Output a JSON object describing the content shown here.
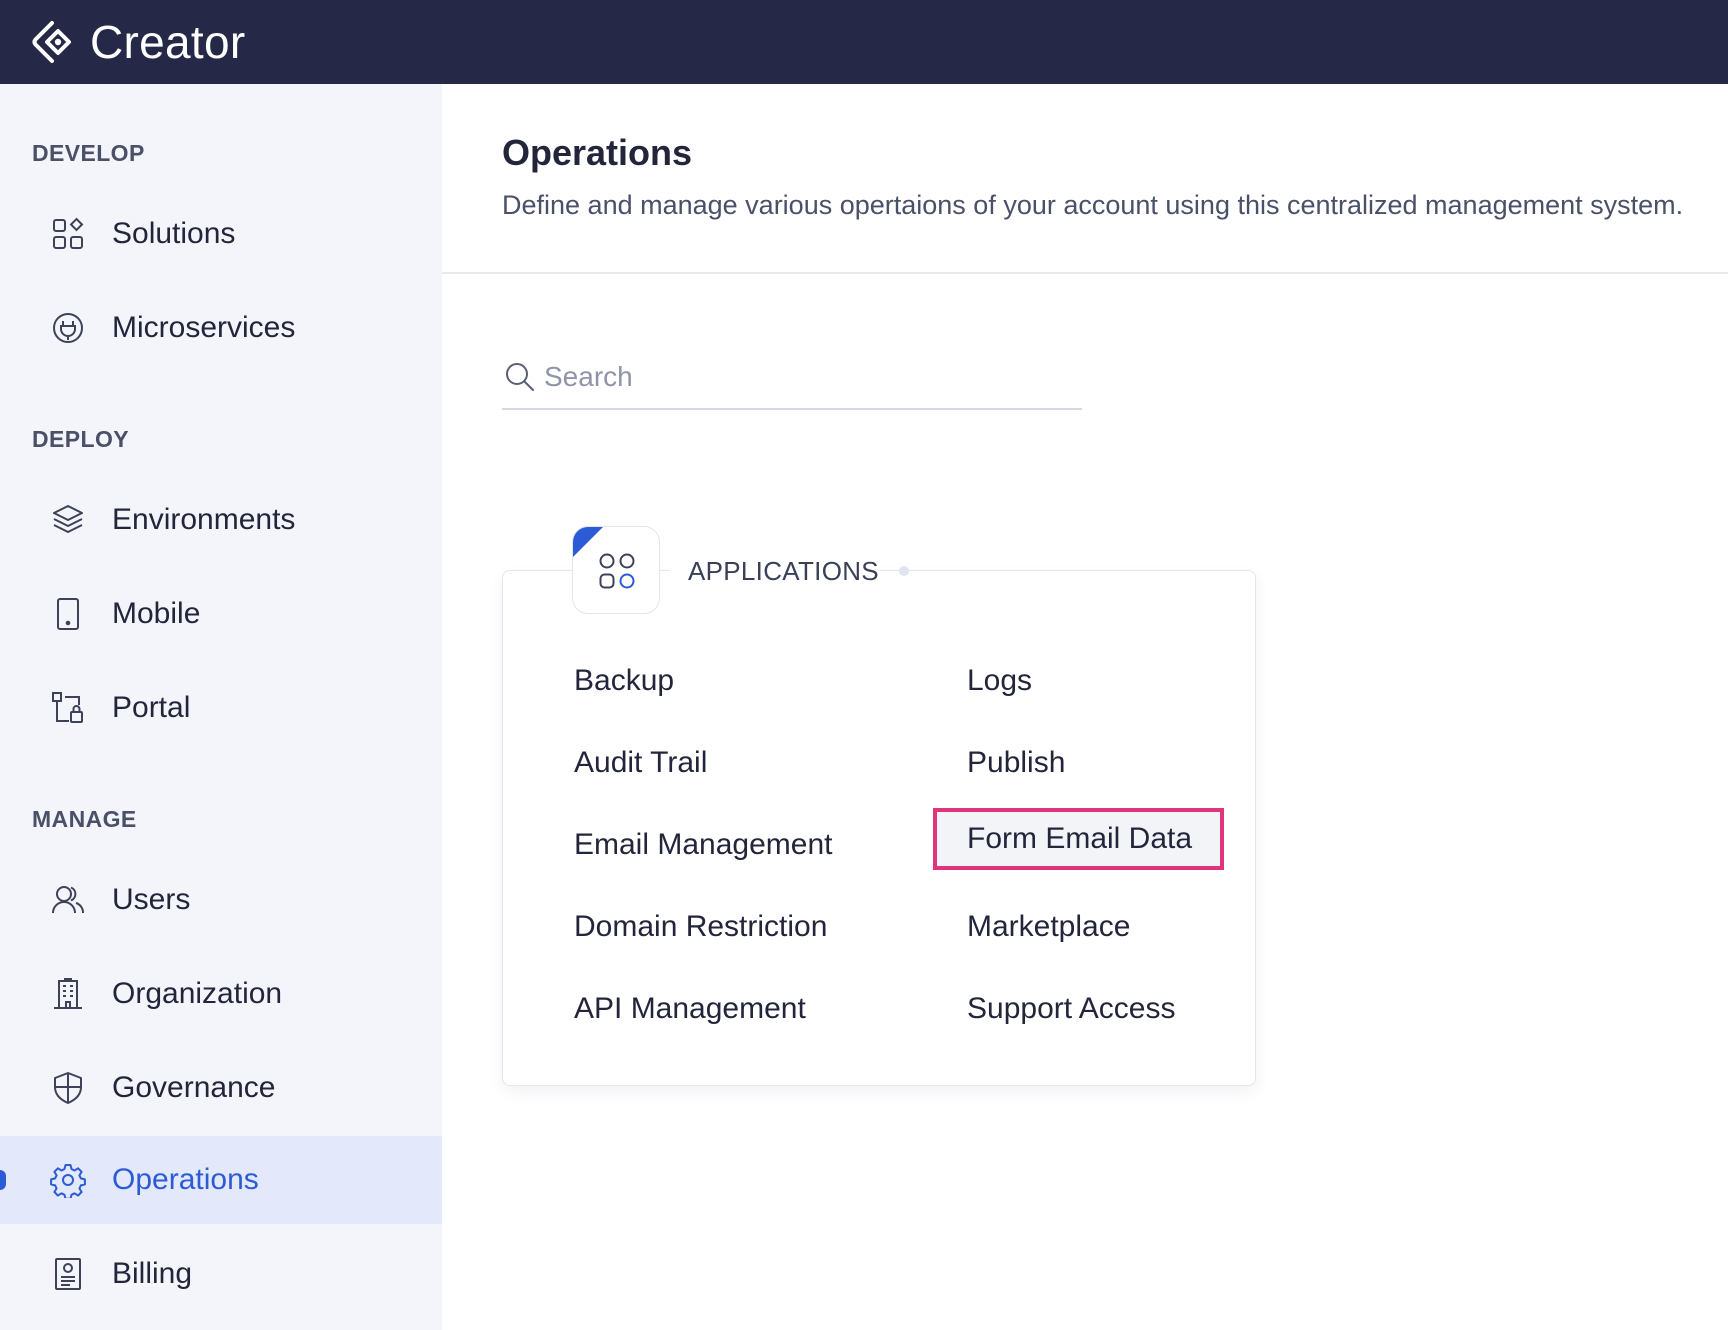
{
  "app": {
    "brand": "Creator"
  },
  "sidebar": {
    "sections": [
      {
        "title": "DEVELOP",
        "items": [
          {
            "label": "Solutions",
            "icon": "solutions-icon"
          },
          {
            "label": "Microservices",
            "icon": "plug-icon"
          }
        ]
      },
      {
        "title": "DEPLOY",
        "items": [
          {
            "label": "Environments",
            "icon": "layers-icon"
          },
          {
            "label": "Mobile",
            "icon": "mobile-icon"
          },
          {
            "label": "Portal",
            "icon": "portal-icon"
          }
        ]
      },
      {
        "title": "MANAGE",
        "items": [
          {
            "label": "Users",
            "icon": "users-icon"
          },
          {
            "label": "Organization",
            "icon": "building-icon"
          },
          {
            "label": "Governance",
            "icon": "shield-icon"
          },
          {
            "label": "Operations",
            "icon": "gear-icon",
            "active": true
          },
          {
            "label": "Billing",
            "icon": "billing-icon"
          }
        ]
      }
    ]
  },
  "main": {
    "title": "Operations",
    "description": "Define and manage various opertaions of your account using this centralized management system.",
    "search": {
      "placeholder": "Search",
      "value": ""
    },
    "card": {
      "heading": "APPLICATIONS",
      "icon": "apps-icon",
      "left_links": [
        "Backup",
        "Audit Trail",
        "Email Management",
        "Domain Restriction",
        "API Management"
      ],
      "right_links": [
        "Logs",
        "Publish",
        "Form Email Data",
        "Marketplace",
        "Support Access"
      ],
      "highlighted": "Form Email Data"
    }
  },
  "colors": {
    "topbar": "#262848",
    "accent": "#2c5bd6",
    "highlight_border": "#e0357a",
    "active_bg": "#e3e8fa"
  }
}
